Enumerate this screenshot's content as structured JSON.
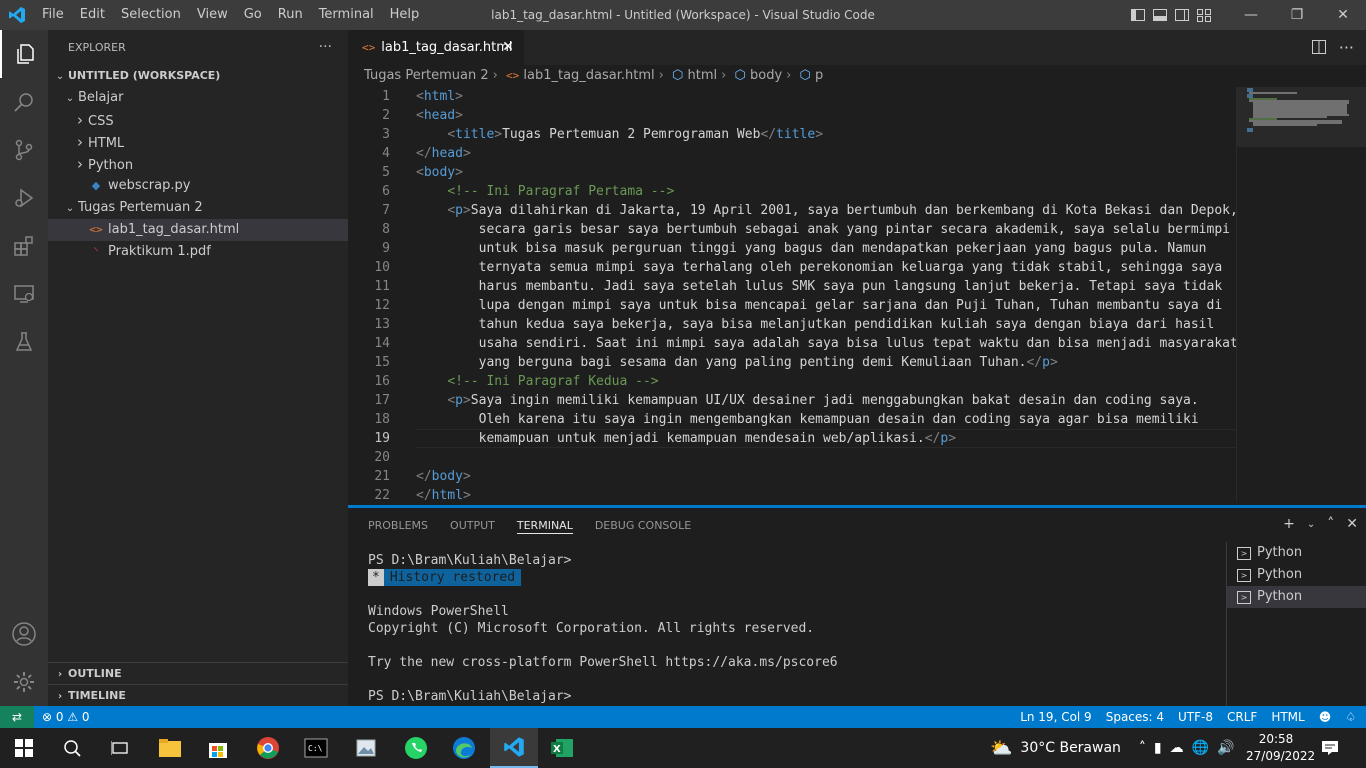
{
  "titlebar": {
    "menu": [
      "File",
      "Edit",
      "Selection",
      "View",
      "Go",
      "Run",
      "Terminal",
      "Help"
    ],
    "title": "lab1_tag_dasar.html - Untitled (Workspace) - Visual Studio Code"
  },
  "sidebar": {
    "header": "EXPLORER",
    "more": "···",
    "workspace": "UNTITLED (WORKSPACE)",
    "items": [
      {
        "label": "Belajar",
        "depth": 1,
        "type": "folder-open"
      },
      {
        "label": "CSS",
        "depth": 2,
        "type": "folder"
      },
      {
        "label": "HTML",
        "depth": 2,
        "type": "folder"
      },
      {
        "label": "Python",
        "depth": 2,
        "type": "folder"
      },
      {
        "label": "webscrap.py",
        "depth": 2,
        "type": "python"
      },
      {
        "label": "Tugas Pertemuan 2",
        "depth": 1,
        "type": "folder-open"
      },
      {
        "label": "lab1_tag_dasar.html",
        "depth": 2,
        "type": "html",
        "selected": true
      },
      {
        "label": "Praktikum 1.pdf",
        "depth": 2,
        "type": "pdf"
      }
    ],
    "outline": "OUTLINE",
    "timeline": "TIMELINE"
  },
  "editor": {
    "tab": "lab1_tag_dasar.html",
    "breadcrumb": [
      "Tugas Pertemuan 2",
      "lab1_tag_dasar.html",
      "html",
      "body",
      "p"
    ],
    "current_line": 19,
    "lines": [
      {
        "n": "1",
        "html": "<span class=\"br\">&lt;</span><span class=\"tg\">html</span><span class=\"br\">&gt;</span>"
      },
      {
        "n": "2",
        "html": "<span class=\"br\">&lt;</span><span class=\"tg\">head</span><span class=\"br\">&gt;</span>"
      },
      {
        "n": "3",
        "html": "    <span class=\"br\">&lt;</span><span class=\"tg\">title</span><span class=\"br\">&gt;</span>Tugas Pertemuan 2 Pemrograman Web<span class=\"br\">&lt;/</span><span class=\"tg\">title</span><span class=\"br\">&gt;</span>"
      },
      {
        "n": "4",
        "html": "<span class=\"br\">&lt;/</span><span class=\"tg\">head</span><span class=\"br\">&gt;</span>"
      },
      {
        "n": "5",
        "html": "<span class=\"br\">&lt;</span><span class=\"tg\">body</span><span class=\"br\">&gt;</span>"
      },
      {
        "n": "6",
        "html": "    <span class=\"cm\">&lt;!-- Ini Paragraf Pertama --&gt;</span>"
      },
      {
        "n": "7",
        "html": "    <span class=\"br\">&lt;</span><span class=\"tg\">p</span><span class=\"br\">&gt;</span>Saya dilahirkan di Jakarta, 19 April 2001, saya bertumbuh dan berkembang di Kota Bekasi dan Depok,"
      },
      {
        "n": "8",
        "html": "        secara garis besar saya bertumbuh sebagai anak yang pintar secara akademik, saya selalu bermimpi"
      },
      {
        "n": "9",
        "html": "        untuk bisa masuk perguruan tinggi yang bagus dan mendapatkan pekerjaan yang bagus pula. Namun"
      },
      {
        "n": "10",
        "html": "        ternyata semua mimpi saya terhalang oleh perekonomian keluarga yang tidak stabil, sehingga saya"
      },
      {
        "n": "11",
        "html": "        harus membantu. Jadi saya setelah lulus SMK saya pun langsung lanjut bekerja. Tetapi saya tidak"
      },
      {
        "n": "12",
        "html": "        lupa dengan mimpi saya untuk bisa mencapai gelar sarjana dan Puji Tuhan, Tuhan membantu saya di"
      },
      {
        "n": "13",
        "html": "        tahun kedua saya bekerja, saya bisa melanjutkan pendidikan kuliah saya dengan biaya dari hasil"
      },
      {
        "n": "14",
        "html": "        usaha sendiri. Saat ini mimpi saya adalah saya bisa lulus tepat waktu dan bisa menjadi masyarakat"
      },
      {
        "n": "15",
        "html": "        yang berguna bagi sesama dan yang paling penting demi Kemuliaan Tuhan.<span class=\"br\">&lt;/</span><span class=\"tg\">p</span><span class=\"br\">&gt;</span>"
      },
      {
        "n": "16",
        "html": "    <span class=\"cm\">&lt;!-- Ini Paragraf Kedua --&gt;</span>"
      },
      {
        "n": "17",
        "html": "    <span class=\"br\">&lt;</span><span class=\"tg\">p</span><span class=\"br\">&gt;</span>Saya ingin memiliki kemampuan UI/UX desainer jadi menggabungkan bakat desain dan coding saya."
      },
      {
        "n": "18",
        "html": "        Oleh karena itu saya ingin mengembangkan kemampuan desain dan coding saya agar bisa memiliki"
      },
      {
        "n": "19",
        "html": "        kemampuan untuk menjadi kemampuan mendesain web/aplikasi.<span class=\"br\">&lt;/</span><span class=\"tg\">p</span><span class=\"br\">&gt;</span>"
      },
      {
        "n": "20",
        "html": ""
      },
      {
        "n": "21",
        "html": "<span class=\"br\">&lt;/</span><span class=\"tg\">body</span><span class=\"br\">&gt;</span>"
      },
      {
        "n": "22",
        "html": "<span class=\"br\">&lt;/</span><span class=\"tg\">html</span><span class=\"br\">&gt;</span>"
      }
    ]
  },
  "panel": {
    "tabs": [
      "PROBLEMS",
      "OUTPUT",
      "TERMINAL",
      "DEBUG CONSOLE"
    ],
    "active_tab": "TERMINAL",
    "terminal": {
      "prompt1": "PS D:\\Bram\\Kuliah\\Belajar>",
      "restored_star": "*",
      "restored_text": "History restored",
      "line_ps": "Windows PowerShell",
      "line_copyright": "Copyright (C) Microsoft Corporation. All rights reserved.",
      "line_try": "Try the new cross-platform PowerShell https://aka.ms/pscore6",
      "prompt2": "PS D:\\Bram\\Kuliah\\Belajar>"
    },
    "terminals": [
      "Python",
      "Python",
      "Python"
    ],
    "selected_terminal": 2
  },
  "status": {
    "problems": "⊗ 0 ⚠ 0",
    "position": "Ln 19, Col 9",
    "spaces": "Spaces: 4",
    "encoding": "UTF-8",
    "eol": "CRLF",
    "language": "HTML"
  },
  "taskbar": {
    "weather": "30°C  Berawan",
    "time": "20:58",
    "date": "27/09/2022"
  },
  "colors": {
    "accent": "#007acc",
    "tag": "#569cd6",
    "comment": "#6a9955"
  }
}
